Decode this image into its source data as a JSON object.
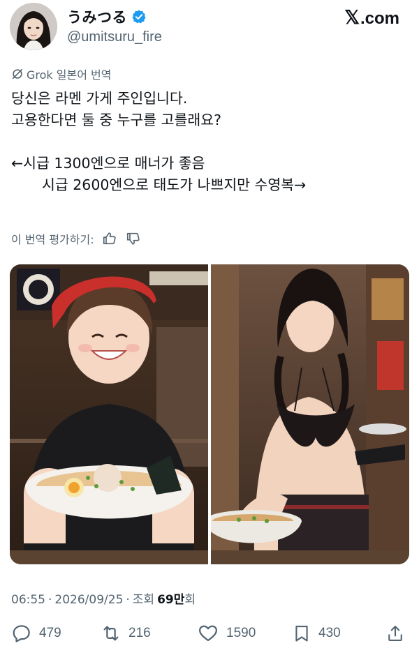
{
  "author": {
    "display_name": "うみつる",
    "handle": "@umitsuru_fire",
    "verified": true,
    "accent_color": "#1d9bf0"
  },
  "site": {
    "logo_mark": "𝕏",
    "logo_text": ".com"
  },
  "translation": {
    "label": "Grok 일본어 번역",
    "icon": "grok-icon"
  },
  "tweet": {
    "line1": "당신은 라멘 가게 주인입니다.",
    "line2": "고용한다면 둘 중 누구를 고를래요?",
    "line3": "←시급 1300엔으로 매너가 좋음",
    "line4": "시급 2600엔으로 태도가 나쁘지만 수영복→"
  },
  "rating": {
    "label": "이 번역 평가하기:",
    "up_icon": "thumbs-up-icon",
    "down_icon": "thumbs-down-icon"
  },
  "meta": {
    "time": "06:55",
    "sep1": "·",
    "date": "2026/09/25",
    "sep2": "·",
    "views_label": "조회",
    "views_num": "69만",
    "views_suffix": "회"
  },
  "actions": {
    "replies": "479",
    "reposts": "216",
    "likes": "1590",
    "bookmarks": "430"
  }
}
